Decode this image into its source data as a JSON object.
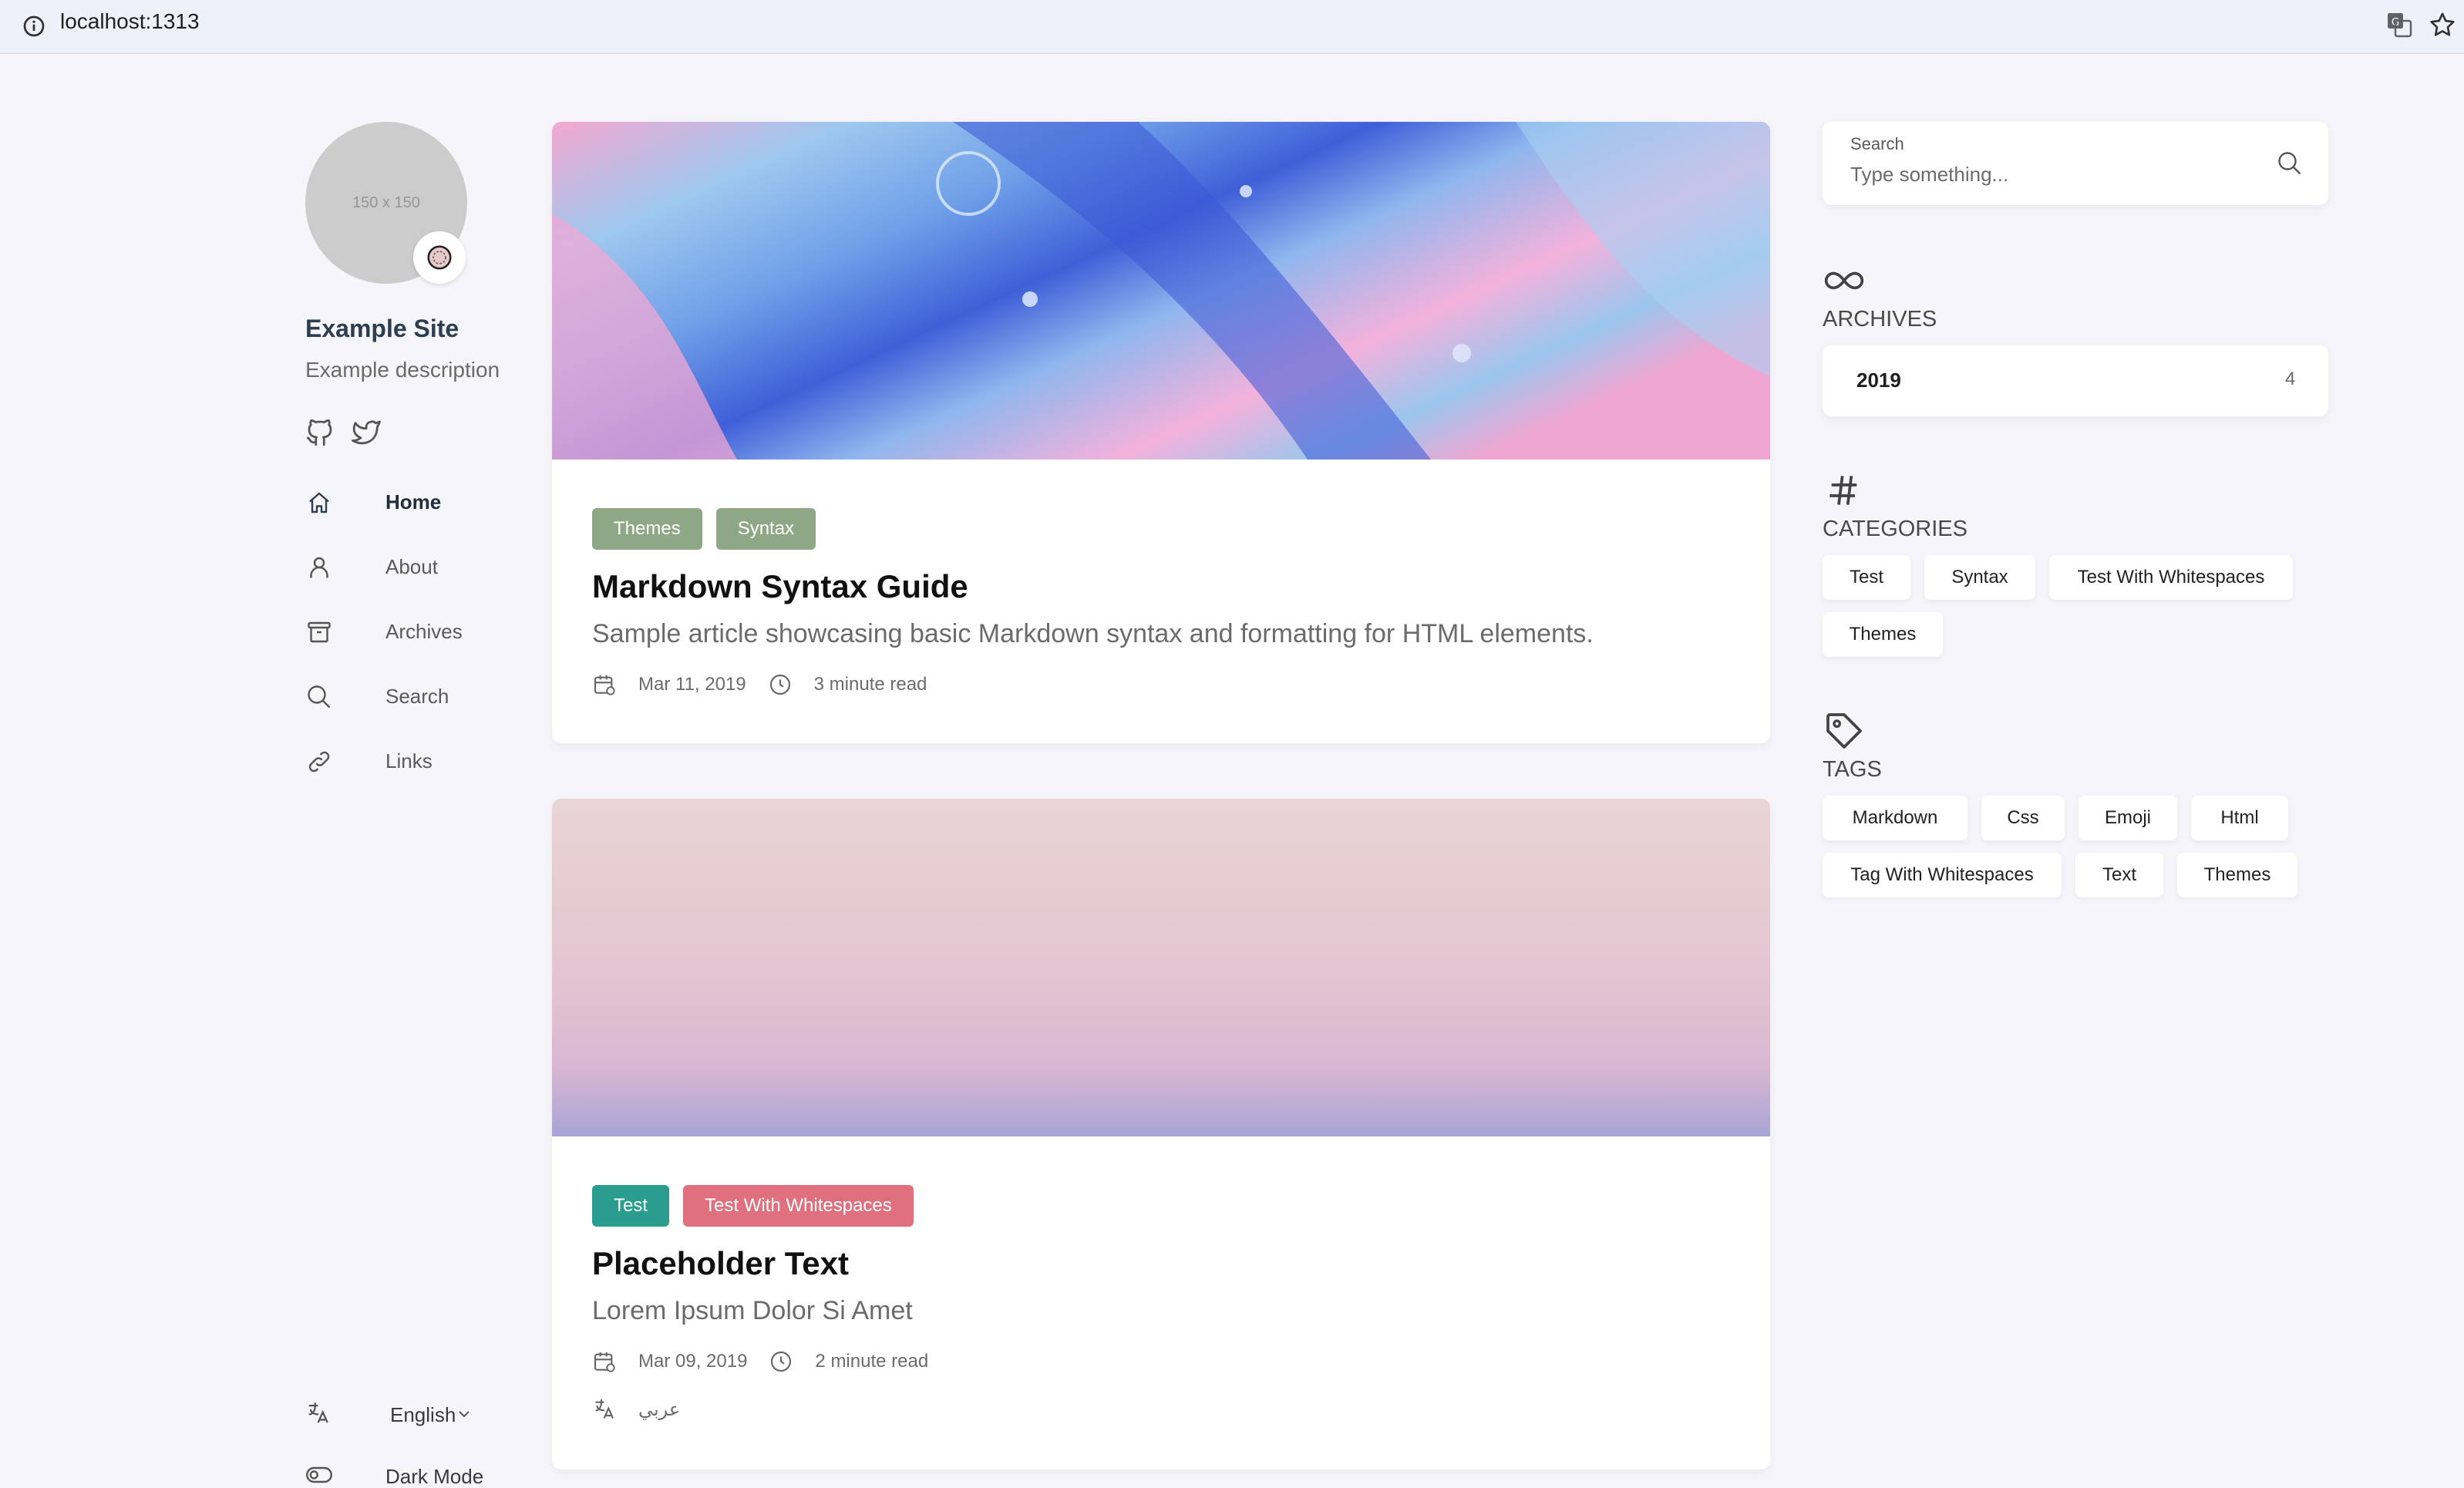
{
  "browser": {
    "url": "localhost:1313"
  },
  "sidebar": {
    "avatar_placeholder": "150 x 150",
    "site_name": "Example Site",
    "site_description": "Example description",
    "nav": [
      {
        "label": "Home",
        "icon": "home-icon",
        "active": true
      },
      {
        "label": "About",
        "icon": "user-icon"
      },
      {
        "label": "Archives",
        "icon": "archive-icon"
      },
      {
        "label": "Search",
        "icon": "search-icon"
      },
      {
        "label": "Links",
        "icon": "link-icon"
      }
    ],
    "language": "English",
    "dark_mode_label": "Dark Mode"
  },
  "articles": [
    {
      "tags": [
        {
          "label": "Themes",
          "color": "#8ea885"
        },
        {
          "label": "Syntax",
          "color": "#8ea885"
        }
      ],
      "title": "Markdown Syntax Guide",
      "subtitle": "Sample article showcasing basic Markdown syntax and formatting for HTML elements.",
      "date": "Mar 11, 2019",
      "read_time": "3 minute read"
    },
    {
      "tags": [
        {
          "label": "Test",
          "color": "#2a9d8f"
        },
        {
          "label": "Test With Whitespaces",
          "color": "#e0707e"
        }
      ],
      "title": "Placeholder Text",
      "subtitle": "Lorem Ipsum Dolor Si Amet",
      "date": "Mar 09, 2019",
      "read_time": "2 minute read",
      "translation": "عربي"
    }
  ],
  "right": {
    "search": {
      "label": "Search",
      "placeholder": "Type something..."
    },
    "archives": {
      "title": "ARCHIVES",
      "items": [
        {
          "year": "2019",
          "count": "4"
        }
      ]
    },
    "categories": {
      "title": "CATEGORIES",
      "items": [
        "Test",
        "Syntax",
        "Test With Whitespaces",
        "Themes"
      ]
    },
    "tags": {
      "title": "TAGS",
      "items": [
        "Markdown",
        "Css",
        "Emoji",
        "Html",
        "Tag With Whitespaces",
        "Text",
        "Themes"
      ]
    }
  }
}
